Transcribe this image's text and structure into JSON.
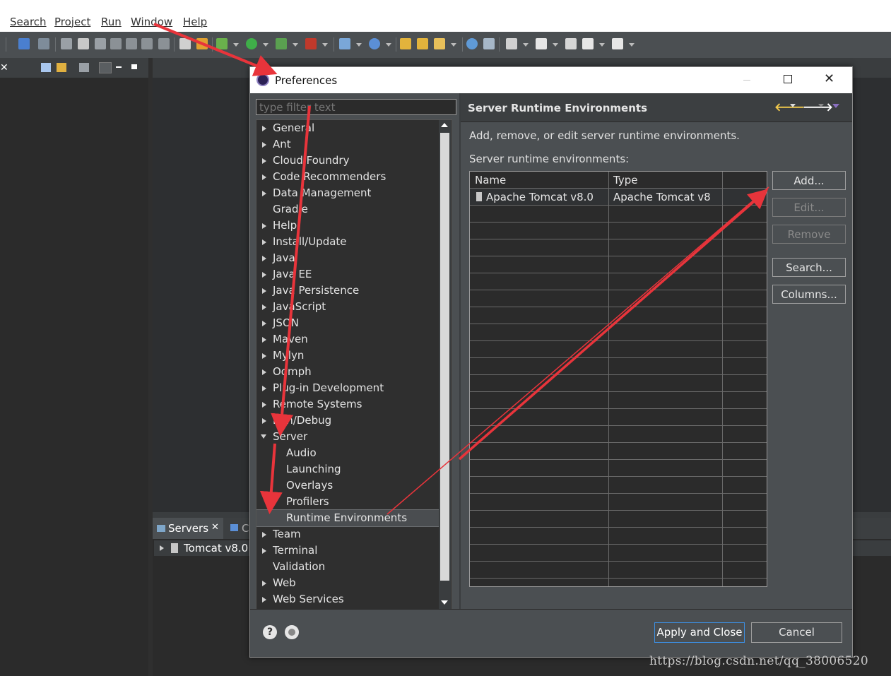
{
  "menu": [
    "Search",
    "Project",
    "Run",
    "Window",
    "Help"
  ],
  "colors": {
    "menubar_bg": "#ffffff",
    "dialog_bg": "#4b4f52",
    "tree_bg": "#2f2f2f",
    "annotation_arrow": "#e8343b"
  },
  "servers_view": {
    "tab_label": "Servers",
    "second_tab_partial": "C",
    "row_label": "Tomcat v8.0"
  },
  "dialog": {
    "title": "Preferences",
    "filter_placeholder": "type filter text",
    "tree": [
      {
        "label": "General",
        "expandable": true
      },
      {
        "label": "Ant",
        "expandable": true
      },
      {
        "label": "Cloud Foundry",
        "expandable": true
      },
      {
        "label": "Code Recommenders",
        "expandable": true
      },
      {
        "label": "Data Management",
        "expandable": true
      },
      {
        "label": "Gradle",
        "expandable": false
      },
      {
        "label": "Help",
        "expandable": true
      },
      {
        "label": "Install/Update",
        "expandable": true
      },
      {
        "label": "Java",
        "expandable": true
      },
      {
        "label": "Java EE",
        "expandable": true
      },
      {
        "label": "Java Persistence",
        "expandable": true
      },
      {
        "label": "JavaScript",
        "expandable": true
      },
      {
        "label": "JSON",
        "expandable": true
      },
      {
        "label": "Maven",
        "expandable": true
      },
      {
        "label": "Mylyn",
        "expandable": true
      },
      {
        "label": "Oomph",
        "expandable": true
      },
      {
        "label": "Plug-in Development",
        "expandable": true
      },
      {
        "label": "Remote Systems",
        "expandable": true
      },
      {
        "label": "Run/Debug",
        "expandable": true
      },
      {
        "label": "Server",
        "expandable": true,
        "expanded": true
      },
      {
        "label": "Audio",
        "child": true
      },
      {
        "label": "Launching",
        "child": true
      },
      {
        "label": "Overlays",
        "child": true
      },
      {
        "label": "Profilers",
        "child": true
      },
      {
        "label": "Runtime Environments",
        "child": true,
        "selected": true
      },
      {
        "label": "Team",
        "expandable": true
      },
      {
        "label": "Terminal",
        "expandable": true
      },
      {
        "label": "Validation",
        "expandable": false
      },
      {
        "label": "Web",
        "expandable": true
      },
      {
        "label": "Web Services",
        "expandable": true
      }
    ],
    "page": {
      "title": "Server Runtime Environments",
      "description": "Add, remove, or edit server runtime environments.",
      "table_label": "Server runtime environments:",
      "columns": [
        "Name",
        "Type"
      ],
      "rows": [
        {
          "name": "Apache Tomcat v8.0",
          "type": "Apache Tomcat v8"
        }
      ],
      "buttons": {
        "add": "Add...",
        "edit": "Edit...",
        "remove": "Remove",
        "search": "Search...",
        "columns": "Columns..."
      }
    },
    "footer": {
      "apply_close": "Apply and Close",
      "cancel": "Cancel"
    }
  },
  "watermark": "https://blog.csdn.net/qq_38006520"
}
